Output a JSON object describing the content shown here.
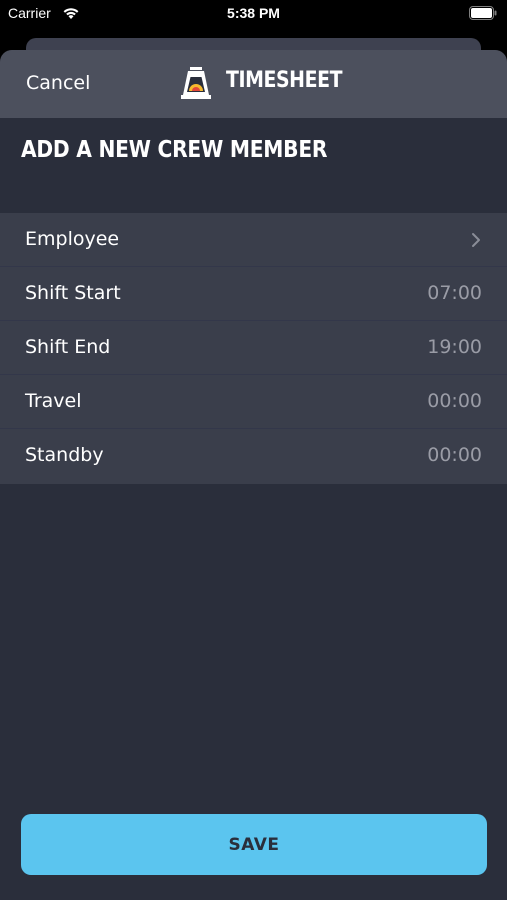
{
  "status_bar": {
    "carrier": "Carrier",
    "time": "5:38 PM",
    "icons": [
      "wifi-icon",
      "battery-icon"
    ]
  },
  "nav": {
    "cancel_label": "Cancel",
    "brand": "TIMESHEET",
    "logo_icon": "lantern-logo"
  },
  "page": {
    "title": "ADD A NEW CREW MEMBER"
  },
  "form": {
    "rows": [
      {
        "label": "Employee",
        "value": "",
        "icon": "chevron-right-icon"
      },
      {
        "label": "Shift Start",
        "value": "07:00"
      },
      {
        "label": "Shift End",
        "value": "19:00"
      },
      {
        "label": "Travel",
        "value": "00:00"
      },
      {
        "label": "Standby",
        "value": "00:00"
      }
    ]
  },
  "actions": {
    "save_label": "SAVE"
  },
  "colors": {
    "background": "#2a2e3b",
    "nav_bar": "#4c505d",
    "row": "#3a3e4b",
    "accent": "#5bc5ef",
    "value_text": "#9a9ca6"
  }
}
